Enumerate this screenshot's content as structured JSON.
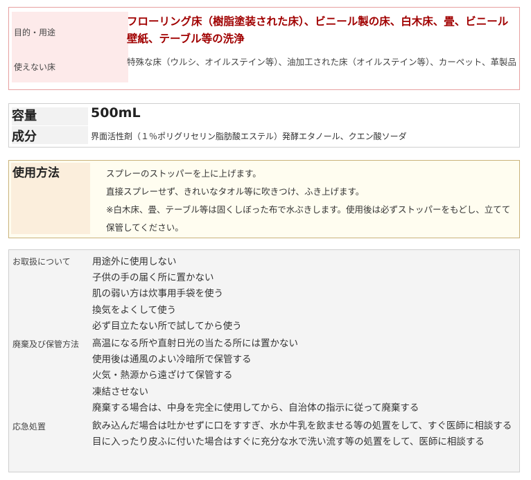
{
  "usage": {
    "purpose_label": "目的・用途",
    "purpose_value": "フローリング床（樹脂塗装された床）、ビニール製の床、白木床、畳、ビニール壁紙、テーブル等の洗浄",
    "nofloor_label": "使えない床",
    "nofloor_value": "特殊な床（ウルシ、オイルステイン等）、油加工された床（オイルステイン等）、カーペット、革製品"
  },
  "spec": {
    "volume_label": "容量",
    "volume_value": "500mL",
    "ingredients_label": "成分",
    "ingredients_value": "界面活性剤（１％ポリグリセリン脂肪酸エステル）発酵エタノール、クエン酸ソーダ"
  },
  "howto": {
    "label": "使用方法",
    "lines": [
      "スプレーのストッパーを上に上げます。",
      "直接スプレーせず、きれいなタオル等に吹きつけ、ふき上げます。",
      "※白木床、畳、テーブル等は固くしぼった布で水ぶきします。使用後は必ずストッパーをもどし、立てて保管してください。"
    ]
  },
  "handling": {
    "care_label": "お取扱について",
    "care_items": [
      "用途外に使用しない",
      "子供の手の届く所に置かない",
      "肌の弱い方は炊事用手袋を使う",
      "換気をよくして使う",
      "必ず目立たない所で試してから使う"
    ],
    "storage_label": "廃棄及び保管方法",
    "storage_items": [
      "高温になる所や直射日光の当たる所には置かない",
      "使用後は通風のよい冷暗所で保管する",
      "火気・熱源から遠ざけて保管する",
      "凍結させない",
      "廃棄する場合は、中身を完全に使用してから、自治体の指示に従って廃棄する"
    ],
    "emergency_label": "応急処置",
    "emergency_items": [
      "飲み込んだ場合は吐かせずに口をすすぎ、水か牛乳を飲ませる等の処置をして、すぐ医師に相談する",
      "目に入ったり皮ふに付いた場合はすぐに充分な水で洗い流す等の処置をして、医師に相談する"
    ]
  }
}
